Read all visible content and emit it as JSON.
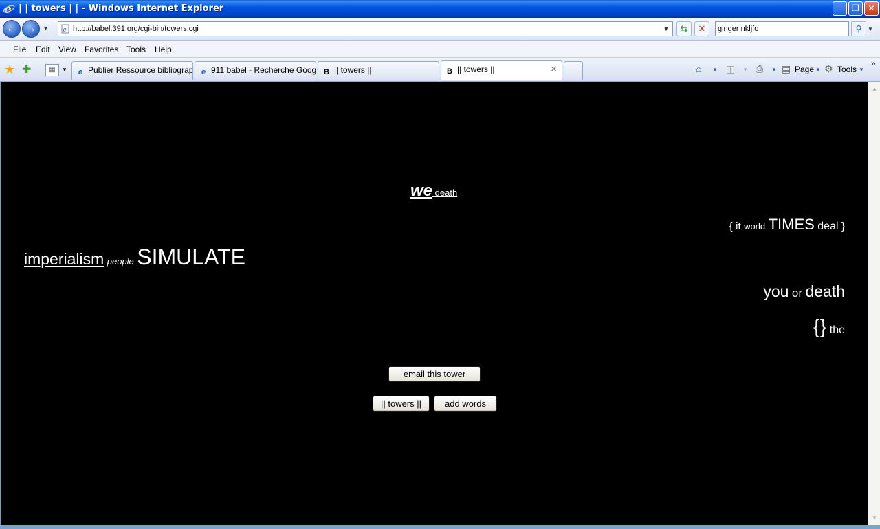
{
  "window": {
    "title": "| | towers | | - Windows Internet Explorer",
    "buttons": {
      "minimize": "_",
      "maximize": "❐",
      "close": "✕"
    }
  },
  "address_bar": {
    "url": "http://babel.391.org/cgi-bin/towers.cgi",
    "search_value": "ginger nkljfo"
  },
  "menu": {
    "items": [
      "File",
      "Edit",
      "View",
      "Favorites",
      "Tools",
      "Help"
    ]
  },
  "tabs": [
    {
      "label": "Publier Ressource bibliograph...",
      "icon": "ie-page-icon"
    },
    {
      "label": "911 babel - Recherche Google",
      "icon": "ie-page-icon"
    },
    {
      "label": "|| towers ||",
      "icon": "B",
      "active": false
    },
    {
      "label": "|| towers ||",
      "icon": "B",
      "active": true
    }
  ],
  "command_bar": {
    "page_label": "Page",
    "tools_label": "Tools"
  },
  "tower": {
    "line1": {
      "a": "we",
      "b": "death"
    },
    "line2": {
      "a": "{",
      "b": "it",
      "c": "world",
      "d": "TIMES",
      "e": "deal",
      "f": "}"
    },
    "line3": {
      "a": "imperialism",
      "b": "people",
      "c": "SIMULATE"
    },
    "line4": {
      "a": "you",
      "b": "or",
      "c": "death"
    },
    "line5": {
      "a": "{}",
      "b": "the"
    }
  },
  "buttons": {
    "email": "email this tower",
    "towers": "|| towers ||",
    "add_words": "add words"
  }
}
